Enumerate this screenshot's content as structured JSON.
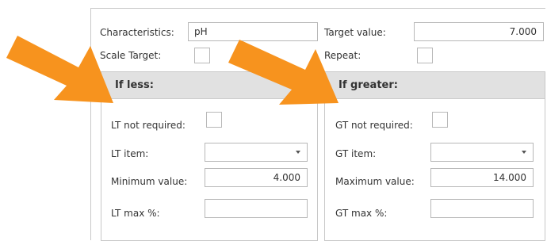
{
  "header": {
    "characteristics_label": "Characteristics:",
    "characteristics_value": "pH",
    "target_value_label": "Target value:",
    "target_value": "7.000",
    "scale_target_label": "Scale Target:",
    "repeat_label": "Repeat:"
  },
  "if_less": {
    "title": "If less:",
    "not_required_label": "LT not required:",
    "item_label": "LT item:",
    "item_value": "",
    "limit_label": "Minimum value:",
    "limit_value": "4.000",
    "max_pct_label": "LT max %:",
    "max_pct_value": ""
  },
  "if_greater": {
    "title": "If greater:",
    "not_required_label": "GT not required:",
    "item_label": "GT item:",
    "item_value": "",
    "limit_label": "Maximum value:",
    "limit_value": "14.000",
    "max_pct_label": "GT max %:",
    "max_pct_value": ""
  },
  "colors": {
    "annotation_arrow": "#f7931e",
    "group_header": "#e1e1e1"
  },
  "annotations": [
    "arrow-pointing-to-if-less",
    "arrow-pointing-to-if-greater"
  ]
}
